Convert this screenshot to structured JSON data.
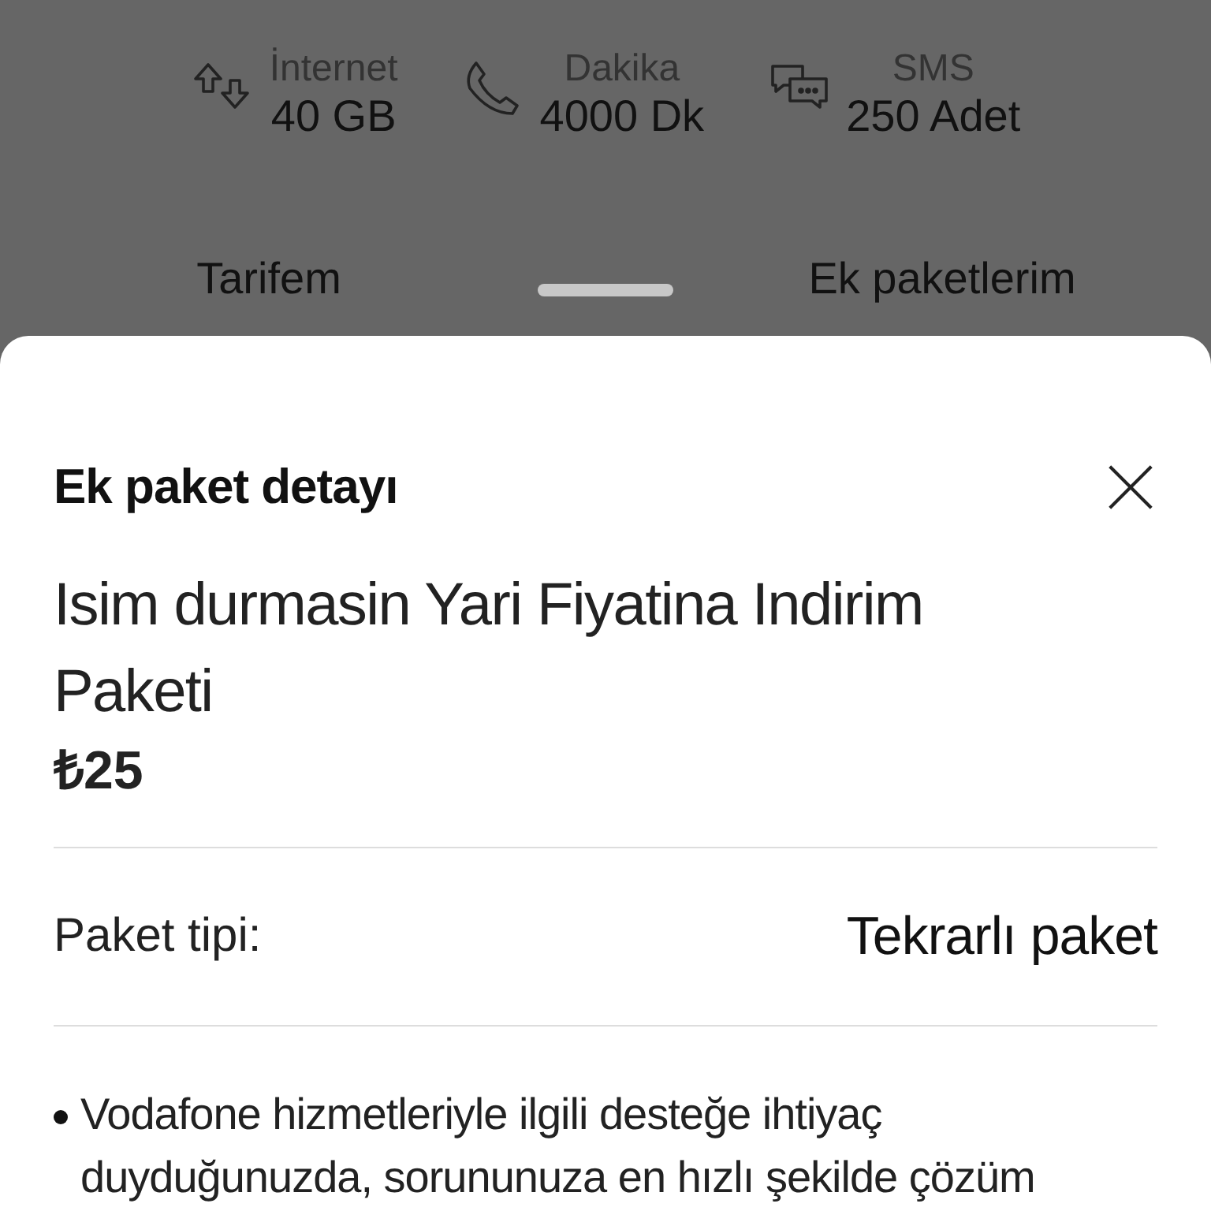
{
  "stats": [
    {
      "kind": "data",
      "label": "İnternet",
      "value": "40 GB"
    },
    {
      "kind": "call",
      "label": "Dakika",
      "value": "4000 Dk"
    },
    {
      "kind": "sms",
      "label": "SMS",
      "value": "250 Adet"
    }
  ],
  "tabs": [
    {
      "label": "Tarifem"
    },
    {
      "label": "Ek paketlerim"
    }
  ],
  "sheet": {
    "title": "Ek paket detayı",
    "package_name": "Isim durmasin Yari Fiyatina Indirim Paketi",
    "price": "₺25",
    "details": [
      {
        "label": "Paket tipi:",
        "value": "Tekrarlı paket"
      }
    ],
    "bullets": [
      "Vodafone hizmetleriyle ilgili desteğe ihtiyaç duyduğunuzda, sorununuza en hızlı şekilde çözüm"
    ]
  }
}
